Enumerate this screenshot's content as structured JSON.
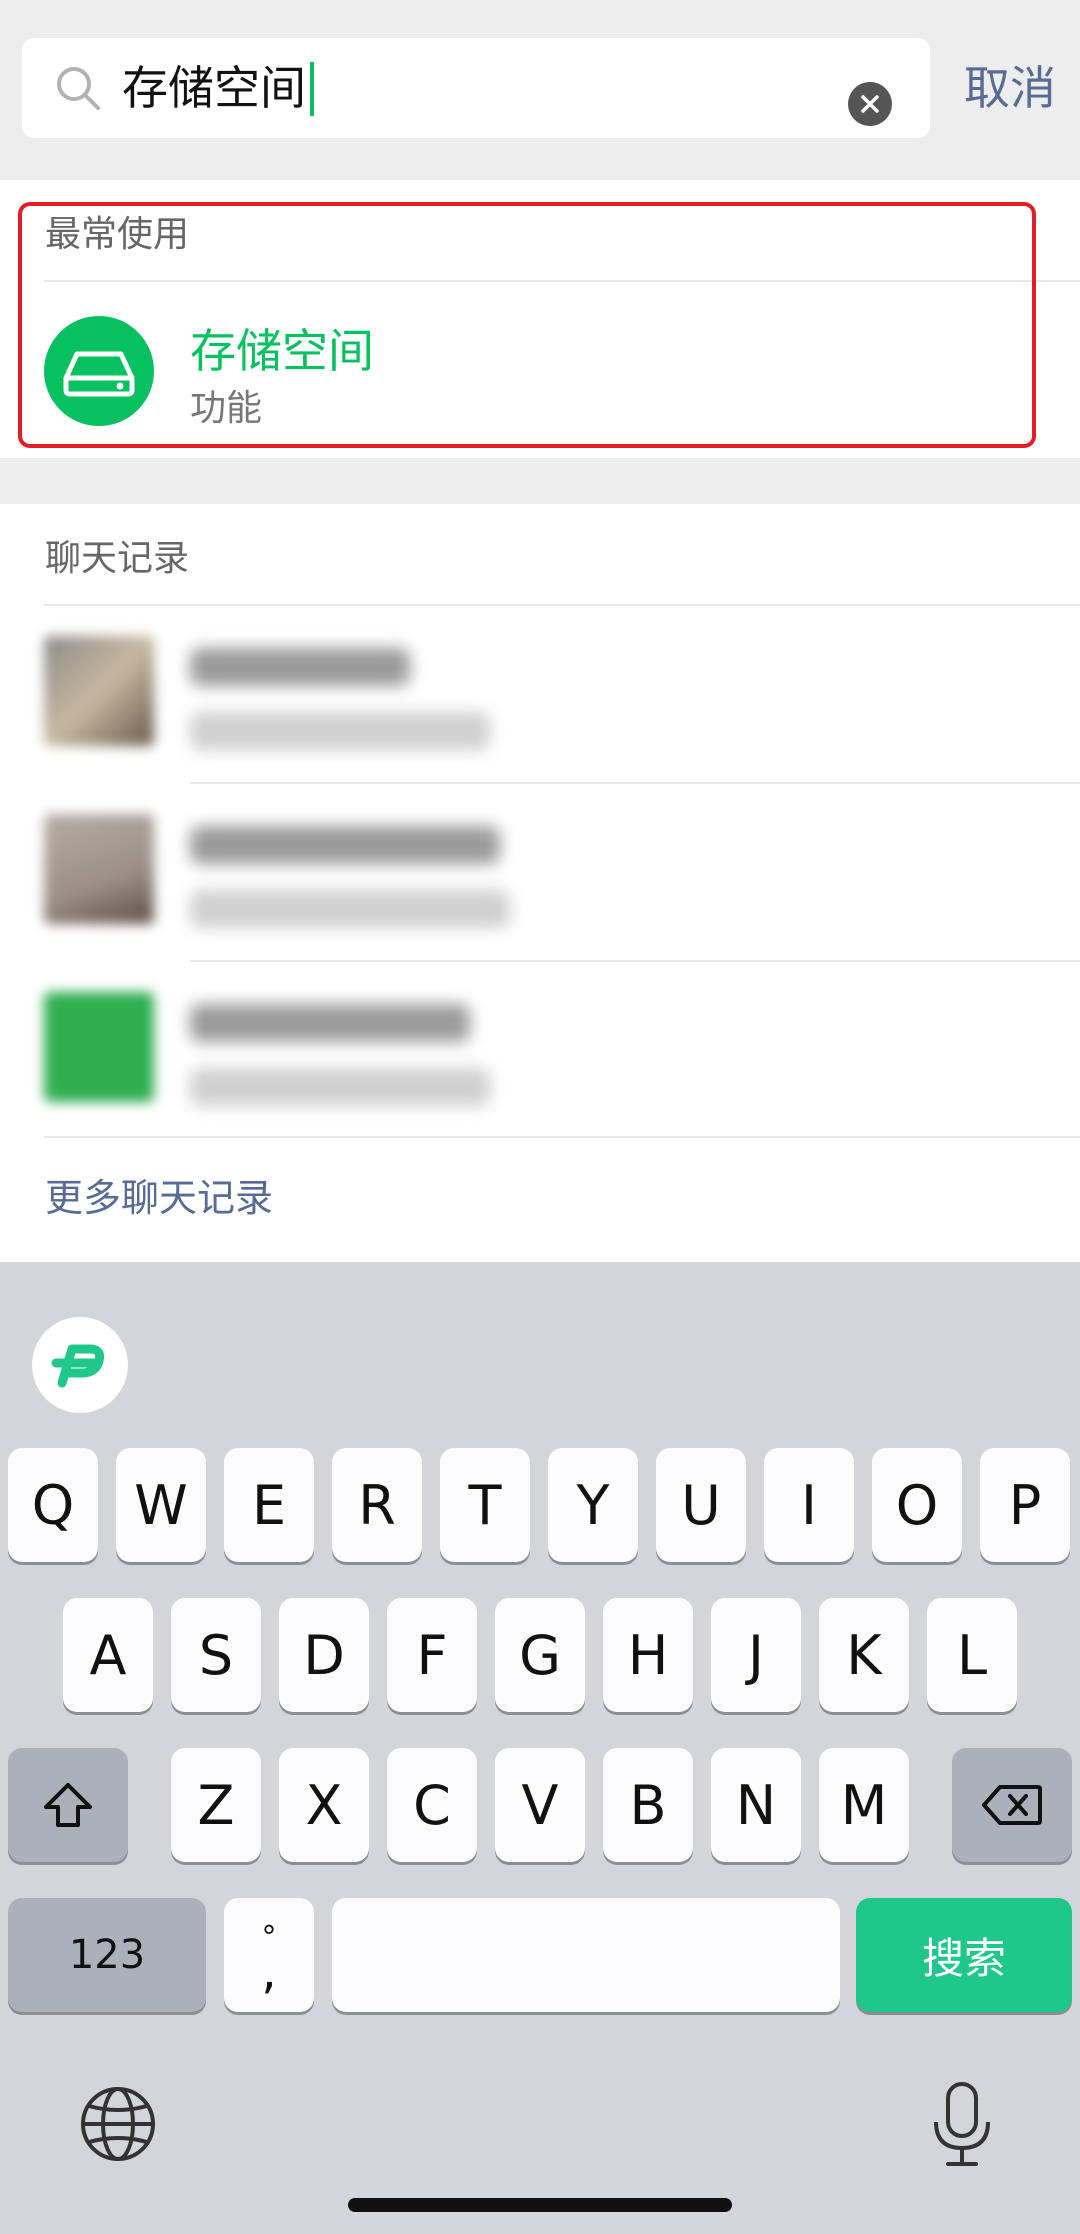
{
  "search": {
    "query": "存储空间",
    "cancel_label": "取消"
  },
  "frequent": {
    "section_title": "最常使用",
    "item": {
      "title": "存储空间",
      "subtitle": "功能"
    }
  },
  "chat_history": {
    "section_title": "聊天记录",
    "more_label": "更多聊天记录"
  },
  "keyboard": {
    "row1": [
      "Q",
      "W",
      "E",
      "R",
      "T",
      "Y",
      "U",
      "I",
      "O",
      "P"
    ],
    "row2": [
      "A",
      "S",
      "D",
      "F",
      "G",
      "H",
      "J",
      "K",
      "L"
    ],
    "row3": [
      "Z",
      "X",
      "C",
      "V",
      "B",
      "N",
      "M"
    ],
    "numbers_label": "123",
    "punct_top": "°",
    "punct_bottom": ",",
    "search_label": "搜索"
  },
  "colors": {
    "accent_green": "#07c160",
    "link_blue": "#576b95",
    "highlight_red": "#e01e24",
    "search_key_green": "#1fc88a"
  }
}
